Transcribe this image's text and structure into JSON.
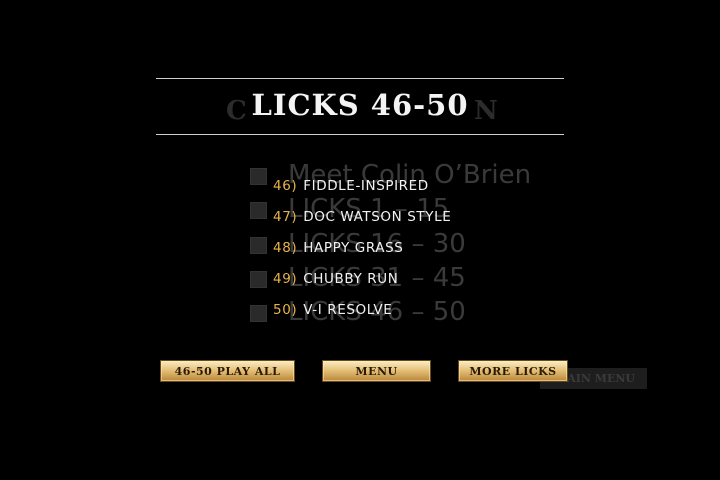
{
  "title": "LICKS 46-50",
  "ghost_layer": {
    "title_fragment": "C",
    "title_fragment_right": "N",
    "line1": "Meet Colin O’Brien",
    "line2": "LICKS 1 – 15",
    "line3": "LICKS 16 – 30",
    "line4": "LICKS 31 – 45",
    "line5": "LICKS 46 – 50",
    "button": "MAIN MENU"
  },
  "licks": [
    {
      "num": "46)",
      "label": "FIDDLE-INSPIRED"
    },
    {
      "num": "47)",
      "label": "DOC WATSON STYLE"
    },
    {
      "num": "48)",
      "label": "HAPPY GRASS"
    },
    {
      "num": "49)",
      "label": "CHUBBY RUN"
    },
    {
      "num": "50)",
      "label": "V-I RESOLVE"
    }
  ],
  "buttons": {
    "play_all": "46-50 PLAY ALL",
    "menu": "MENU",
    "more_licks": "MORE LICKS"
  },
  "colors": {
    "background": "#000000",
    "number_accent": "#e8b24a",
    "button_gold": "#e6c27a"
  }
}
